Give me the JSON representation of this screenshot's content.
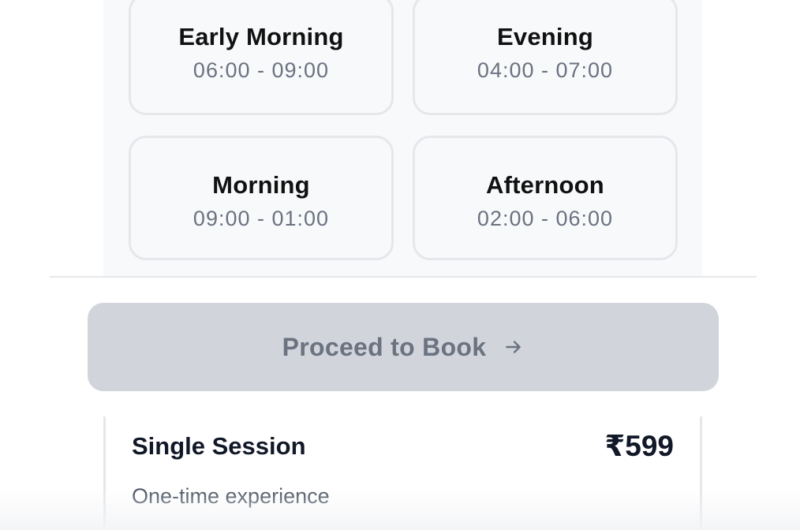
{
  "time_slots": [
    {
      "name": "Early Morning",
      "time": "06:00 - 09:00"
    },
    {
      "name": "Evening",
      "time": "04:00 - 07:00"
    },
    {
      "name": "Morning",
      "time": "09:00 - 01:00"
    },
    {
      "name": "Afternoon",
      "time": "02:00 - 06:00"
    }
  ],
  "booking": {
    "proceed_label": "Proceed to Book",
    "proceed_state": "disabled",
    "arrow_icon": "arrow-right-icon"
  },
  "plan": {
    "title": "Single Session",
    "price": "₹599",
    "description": "One-time experience"
  },
  "colors": {
    "panel_bg": "#f8f9fb",
    "card_border": "#e5e7eb",
    "button_disabled_bg": "#d1d5db",
    "button_disabled_text": "#6b7280",
    "muted_text": "#6b7280",
    "heading_text": "#111827"
  }
}
